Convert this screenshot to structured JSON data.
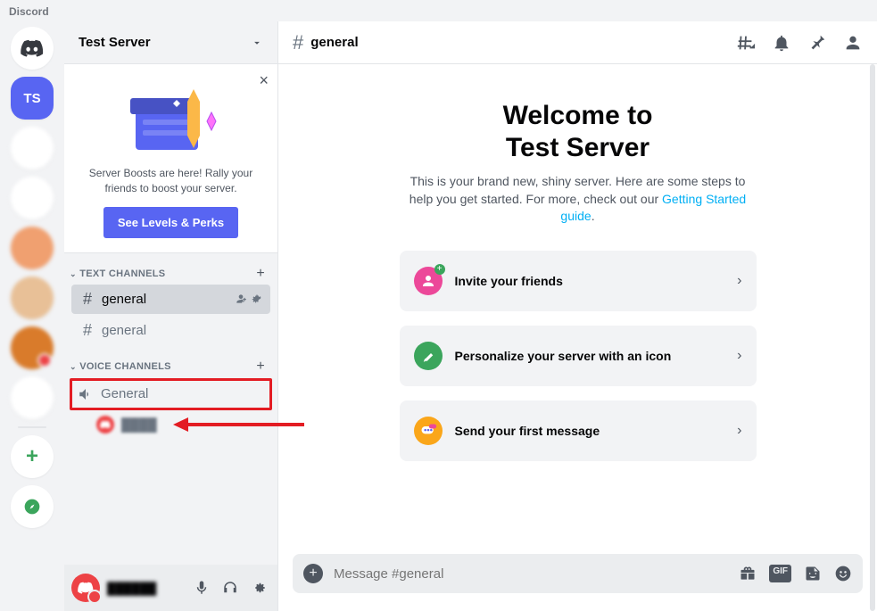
{
  "app_title": "Discord",
  "servers": {
    "active_initials": "TS"
  },
  "server_header": {
    "name": "Test Server"
  },
  "boost": {
    "text": "Server Boosts are here! Rally your friends to boost your server.",
    "button": "See Levels & Perks"
  },
  "categories": {
    "text": {
      "label": "TEXT CHANNELS"
    },
    "voice": {
      "label": "VOICE CHANNELS"
    }
  },
  "text_channels": [
    {
      "name": "general",
      "selected": true
    },
    {
      "name": "general",
      "selected": false
    }
  ],
  "voice_channels": [
    {
      "name": "General"
    }
  ],
  "top_bar": {
    "channel_name": "general"
  },
  "welcome": {
    "title_line1": "Welcome to",
    "title_line2": "Test Server",
    "subtitle_pre": "This is your brand new, shiny server. Here are some steps to help you get started. For more, check out our ",
    "subtitle_link": "Getting Started guide",
    "subtitle_post": "."
  },
  "action_cards": [
    {
      "label": "Invite your friends",
      "color": "#ec4899"
    },
    {
      "label": "Personalize your server with an icon",
      "color": "#3ba55c"
    },
    {
      "label": "Send your first message",
      "color": "#faa61a"
    }
  ],
  "compose": {
    "placeholder": "Message #general",
    "gif": "GIF"
  }
}
